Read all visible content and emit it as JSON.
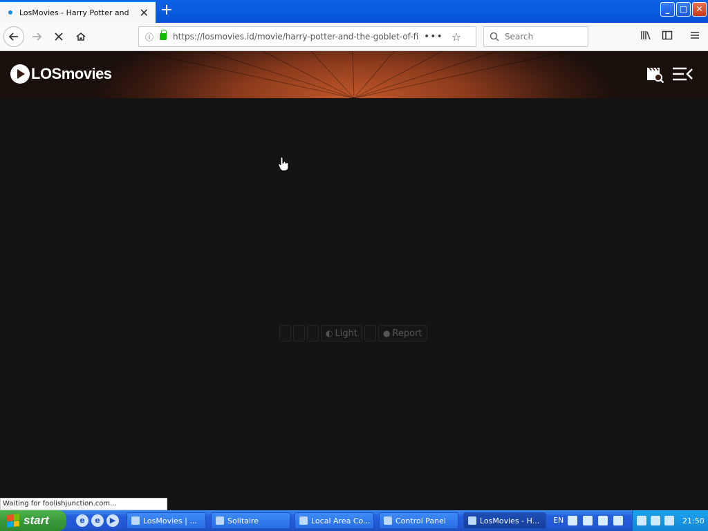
{
  "browser": {
    "tab_title": "LosMovies - Harry Potter and the",
    "tab_close": "✕",
    "new_tab": "+",
    "url": "https://losmovies.id/movie/harry-potter-and-the-goblet-of-fire",
    "search_placeholder": "Search",
    "window_min": "_",
    "window_max": "□",
    "window_close": "✕"
  },
  "site": {
    "logo_text": "LOSmovies"
  },
  "player": {
    "light_label": "Light",
    "report_label": "Report"
  },
  "status_text": "Waiting for foolishjunction.com...",
  "taskbar": {
    "start_label": "start",
    "items": [
      {
        "label": "LosMovies | ..."
      },
      {
        "label": "Solitaire"
      },
      {
        "label": "Local Area Co..."
      },
      {
        "label": "Control Panel"
      },
      {
        "label": "LosMovies - H..."
      }
    ],
    "language": "EN",
    "clock": "21:50"
  }
}
